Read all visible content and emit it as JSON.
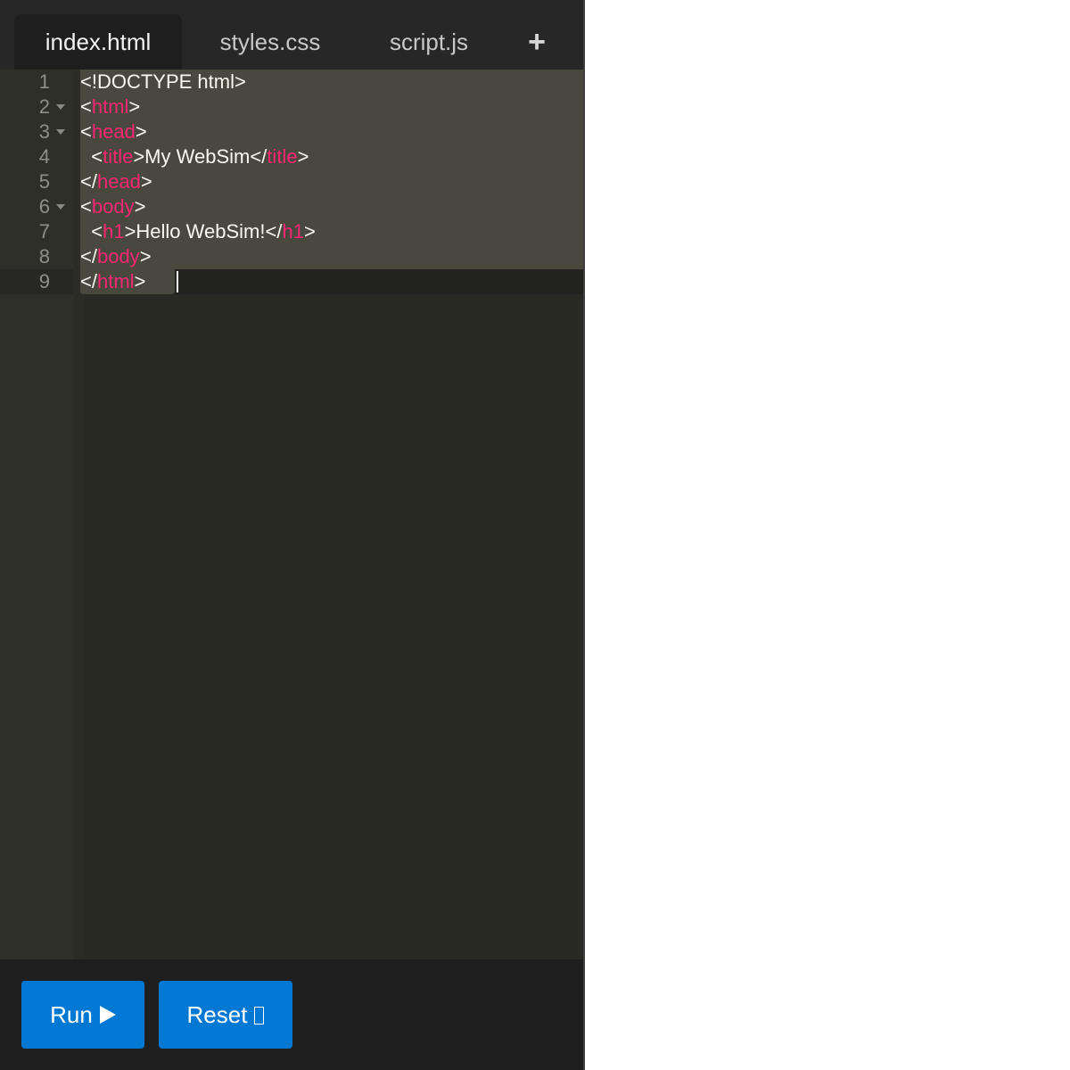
{
  "tabs": [
    {
      "label": "index.html",
      "active": true
    },
    {
      "label": "styles.css",
      "active": false
    },
    {
      "label": "script.js",
      "active": false
    }
  ],
  "add_tab_label": "+",
  "code_lines": [
    {
      "number": "1",
      "foldable": false,
      "tokens": [
        {
          "t": "<!DOCTYPE html>",
          "k": "text"
        }
      ]
    },
    {
      "number": "2",
      "foldable": true,
      "tokens": [
        {
          "t": "<",
          "k": "text"
        },
        {
          "t": "html",
          "k": "tag"
        },
        {
          "t": ">",
          "k": "text"
        }
      ]
    },
    {
      "number": "3",
      "foldable": true,
      "tokens": [
        {
          "t": "<",
          "k": "text"
        },
        {
          "t": "head",
          "k": "tag"
        },
        {
          "t": ">",
          "k": "text"
        }
      ]
    },
    {
      "number": "4",
      "foldable": false,
      "tokens": [
        {
          "t": "  <",
          "k": "text"
        },
        {
          "t": "title",
          "k": "tag"
        },
        {
          "t": ">My WebSim</",
          "k": "text"
        },
        {
          "t": "title",
          "k": "tag"
        },
        {
          "t": ">",
          "k": "text"
        }
      ]
    },
    {
      "number": "5",
      "foldable": false,
      "tokens": [
        {
          "t": "</",
          "k": "text"
        },
        {
          "t": "head",
          "k": "tag"
        },
        {
          "t": ">",
          "k": "text"
        }
      ]
    },
    {
      "number": "6",
      "foldable": true,
      "tokens": [
        {
          "t": "<",
          "k": "text"
        },
        {
          "t": "body",
          "k": "tag"
        },
        {
          "t": ">",
          "k": "text"
        }
      ]
    },
    {
      "number": "7",
      "foldable": false,
      "tokens": [
        {
          "t": "  <",
          "k": "text"
        },
        {
          "t": "h1",
          "k": "tag"
        },
        {
          "t": ">Hello WebSim!</",
          "k": "text"
        },
        {
          "t": "h1",
          "k": "tag"
        },
        {
          "t": ">",
          "k": "text"
        }
      ]
    },
    {
      "number": "8",
      "foldable": false,
      "tokens": [
        {
          "t": "</",
          "k": "text"
        },
        {
          "t": "body",
          "k": "tag"
        },
        {
          "t": ">",
          "k": "text"
        }
      ]
    },
    {
      "number": "9",
      "foldable": false,
      "tokens": [
        {
          "t": "</",
          "k": "text"
        },
        {
          "t": "html",
          "k": "tag"
        },
        {
          "t": ">",
          "k": "text"
        }
      ]
    }
  ],
  "buttons": {
    "run_label": "Run",
    "reset_label": "Reset"
  },
  "icons": {
    "run": "play-icon",
    "reset": "reset-icon",
    "fold": "fold-arrow-icon",
    "add": "plus-icon"
  },
  "colors": {
    "accent": "#0078d4",
    "tag": "#f92672",
    "editor_bg": "#2a2a25",
    "selection": "#49483e"
  }
}
